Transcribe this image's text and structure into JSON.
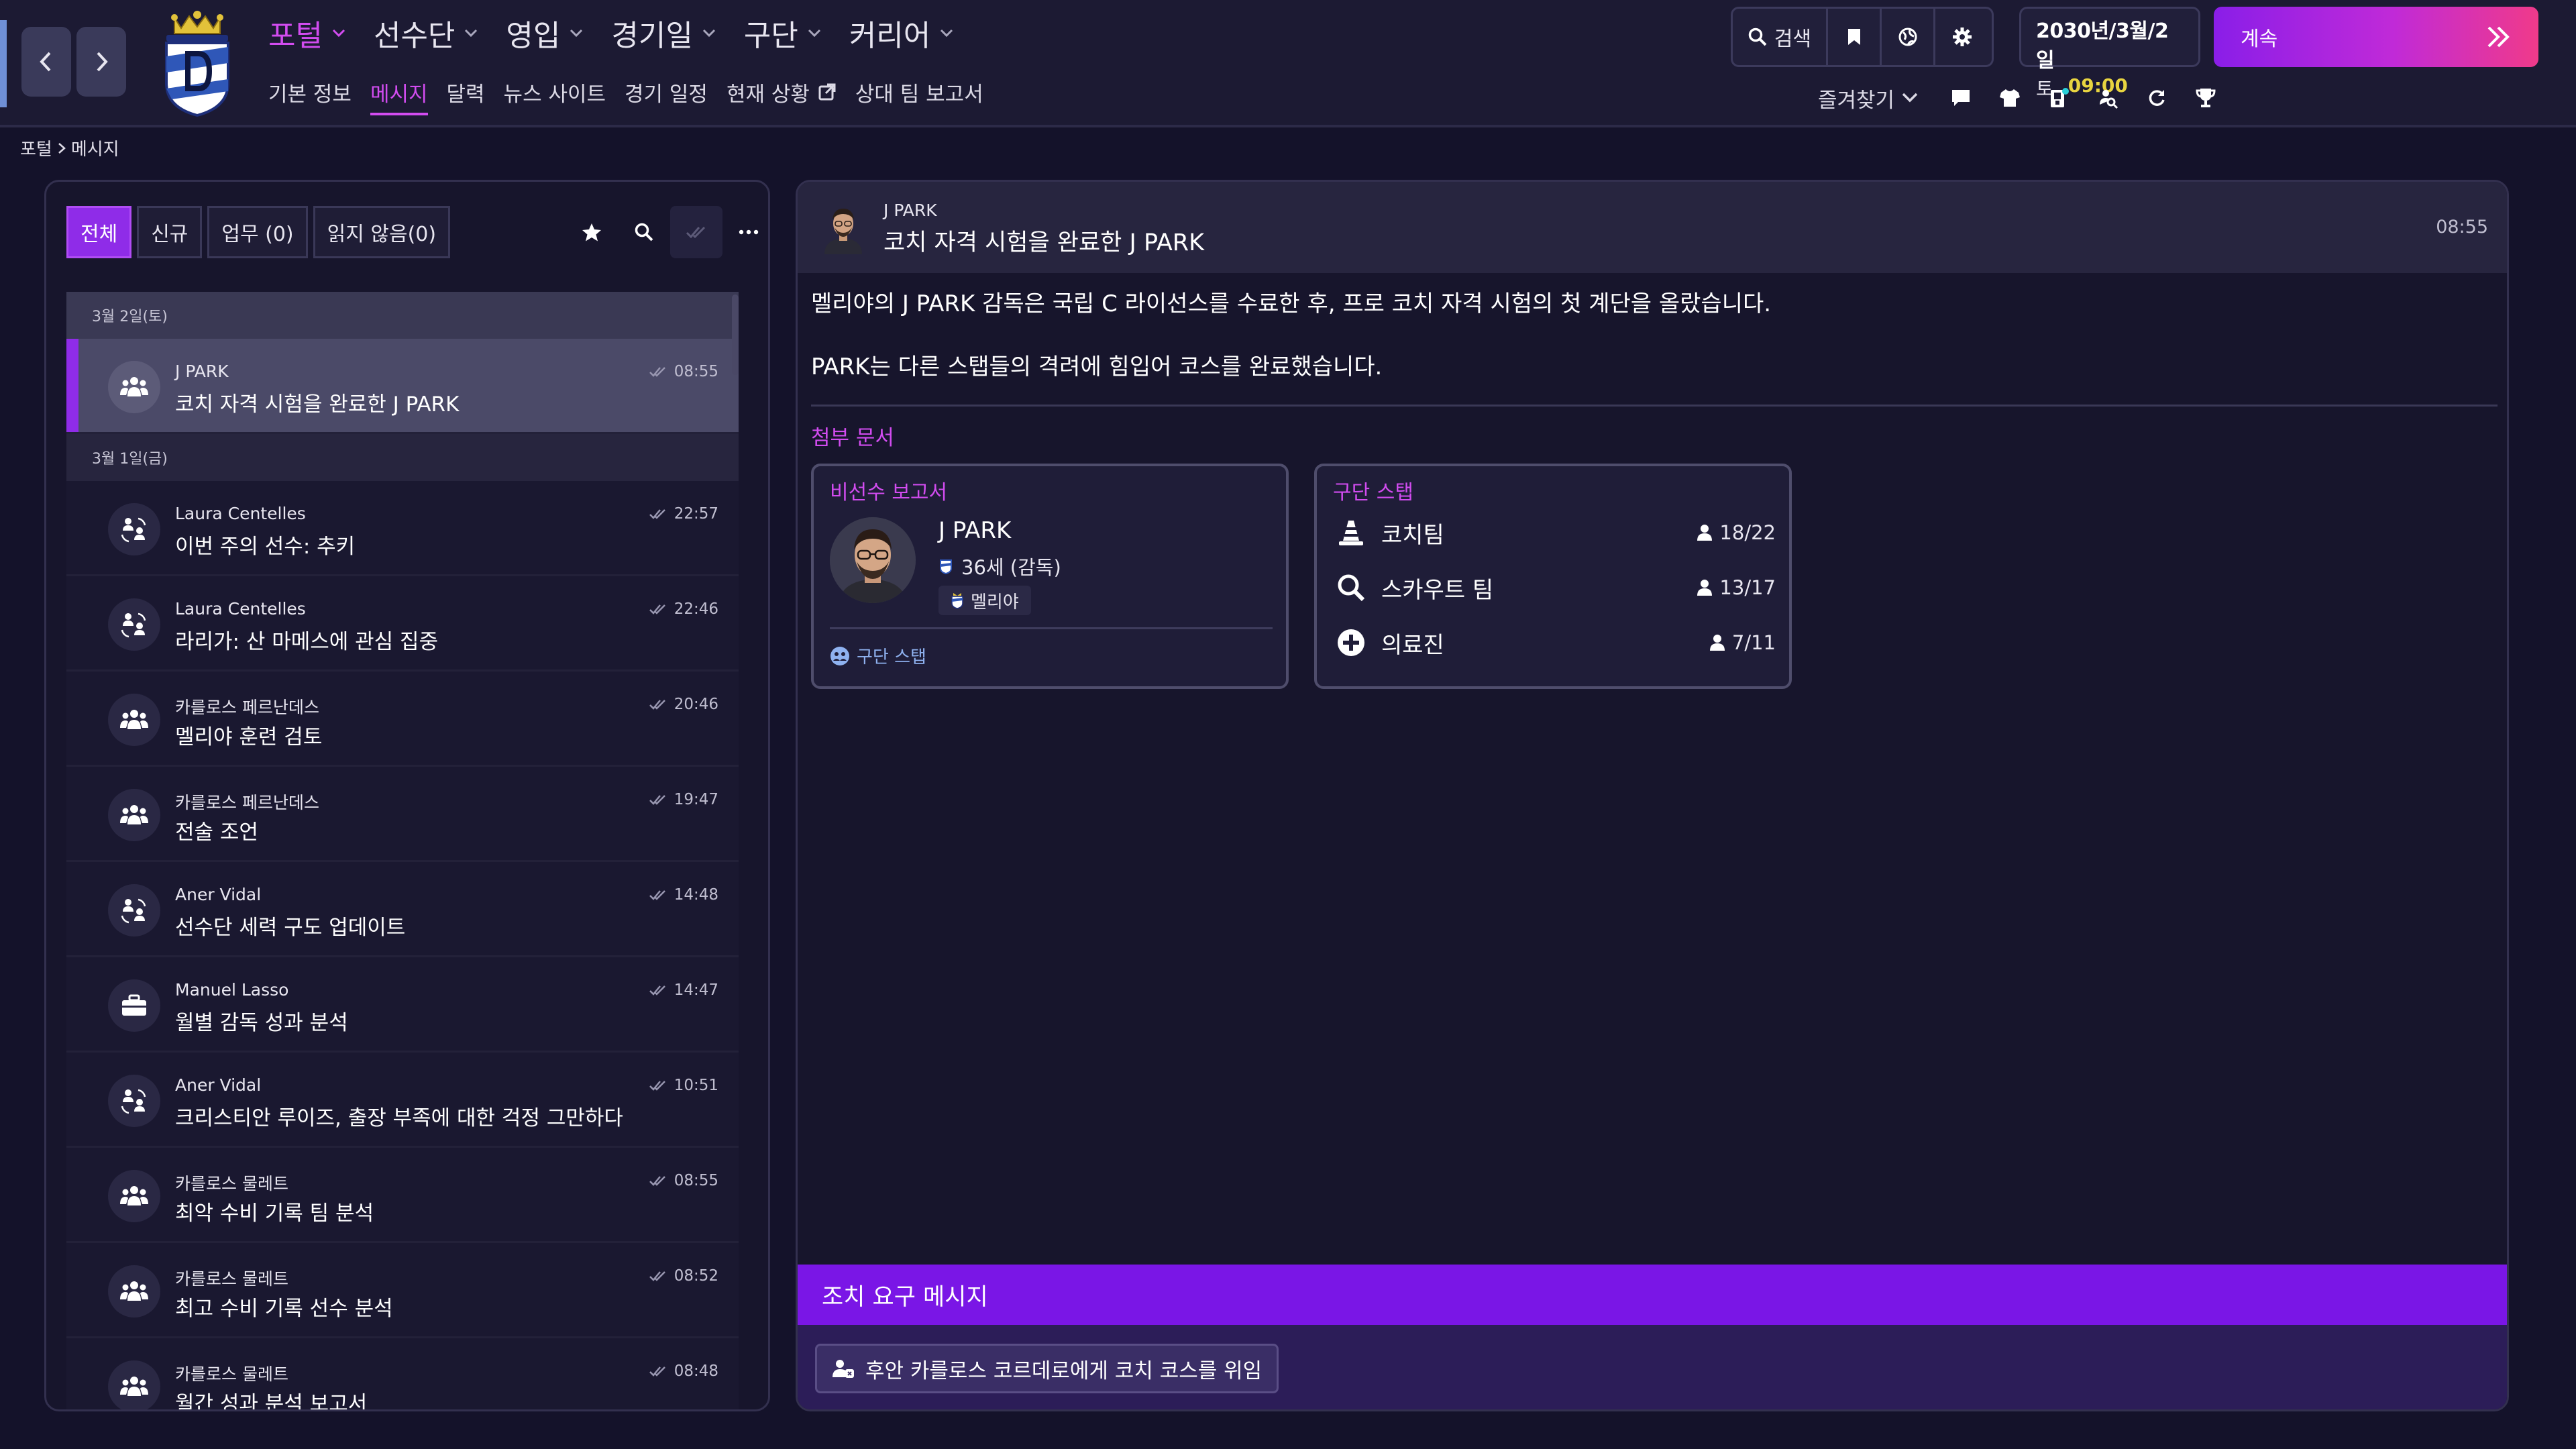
{
  "header": {
    "main_menu": [
      "포털",
      "선수단",
      "영입",
      "경기일",
      "구단",
      "커리어"
    ],
    "sub_menu": [
      "기본 정보",
      "메시지",
      "달력",
      "뉴스 사이트",
      "경기 일정",
      "현재 상황",
      "상대 팀 보고서"
    ],
    "search_label": "검색",
    "date": "2030년/3월/2일",
    "weekday": "토",
    "time": "09:00",
    "continue_label": "계속",
    "favorites_label": "즐겨찾기"
  },
  "breadcrumb": {
    "root": "포털",
    "current": "메시지"
  },
  "filters": {
    "all": "전체",
    "new": "신규",
    "tasks": "업무 (0)",
    "unread": "읽지 않음(0)"
  },
  "inbox": {
    "day1": "3월 2일(토)",
    "day2": "3월 1일(금)",
    "messages": [
      {
        "sender": "J PARK",
        "subject": "코치 자격 시험을 완료한 J PARK",
        "time": "08:55"
      },
      {
        "sender": "Laura Centelles",
        "subject": "이번 주의 선수: 추키",
        "time": "22:57"
      },
      {
        "sender": "Laura Centelles",
        "subject": "라리가: 산 마메스에 관심 집중",
        "time": "22:46"
      },
      {
        "sender": "카를로스 페르난데스",
        "subject": "멜리야 훈련 검토",
        "time": "20:46"
      },
      {
        "sender": "카를로스 페르난데스",
        "subject": "전술 조언",
        "time": "19:47"
      },
      {
        "sender": "Aner Vidal",
        "subject": "선수단 세력 구도 업데이트",
        "time": "14:48"
      },
      {
        "sender": "Manuel Lasso",
        "subject": "월별 감독 성과 분석",
        "time": "14:47"
      },
      {
        "sender": "Aner Vidal",
        "subject": "크리스티안 루이즈, 출장 부족에 대한 걱정 그만하다",
        "time": "10:51"
      },
      {
        "sender": "카를로스 물레트",
        "subject": "최악 수비 기록 팀 분석",
        "time": "08:55"
      },
      {
        "sender": "카를로스 물레트",
        "subject": "최고 수비 기록 선수 분석",
        "time": "08:52"
      },
      {
        "sender": "카를로스 물레트",
        "subject": "월간 성과 분석 보고서",
        "time": "08:48"
      }
    ]
  },
  "message": {
    "sender": "J PARK",
    "subject": "코치 자격 시험을 완료한 J PARK",
    "time": "08:55",
    "body_p1": "멜리야의 J PARK 감독은 국립 C 라이선스를 수료한 후, 프로 코치 자격 시험의 첫 계단을 올랐습니다.",
    "body_p2": "PARK는 다른 스탭들의 격려에 힘입어 코스를 완료했습니다.",
    "attachments_title": "첨부 문서",
    "card1": {
      "title": "비선수 보고서",
      "name": "J PARK",
      "age": "36세 (감독)",
      "club": "멜리야",
      "link": "구단 스탭"
    },
    "card2": {
      "title": "구단 스탭",
      "rows": [
        {
          "name": "코치팀",
          "count": "18/22",
          "icon": "cone-icon"
        },
        {
          "name": "스카우트 팀",
          "count": "13/17",
          "icon": "magnifier-icon"
        },
        {
          "name": "의료진",
          "count": "7/11",
          "icon": "medical-cross-icon"
        }
      ]
    },
    "action_title": "조치 요구 메시지",
    "action_button": "후안 카를로스 코르데로에게 코치 코스를 위임"
  },
  "colors": {
    "accent": "#d24cf0",
    "primary": "#8f2ce8",
    "background": "#14122a",
    "time_highlight": "#e8d440"
  }
}
